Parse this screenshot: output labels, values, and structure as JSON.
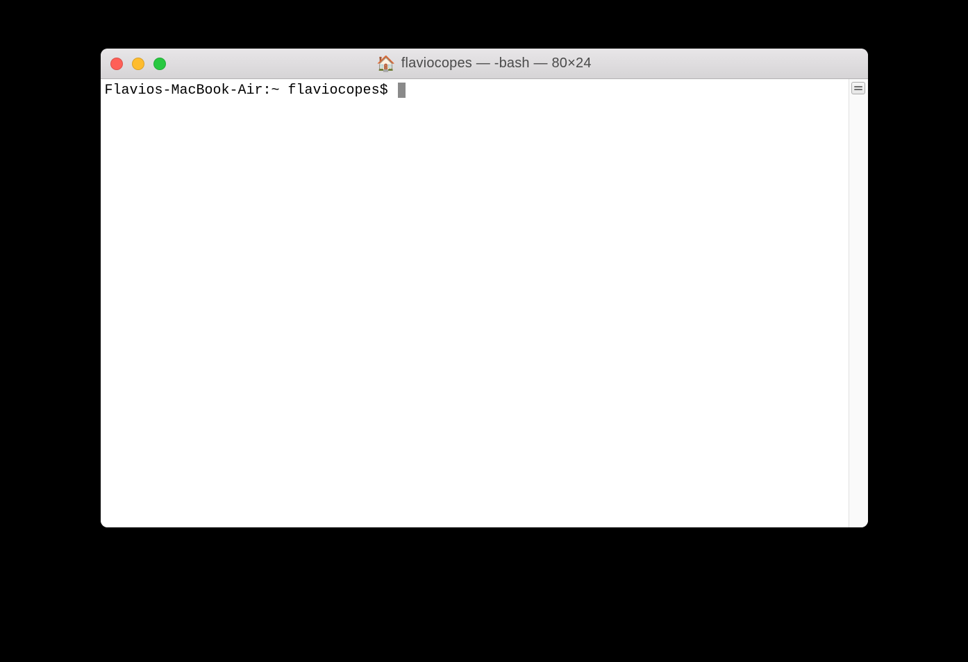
{
  "window": {
    "title": "flaviocopes — -bash — 80×24",
    "icon": "🏠"
  },
  "terminal": {
    "prompt": "Flavios-MacBook-Air:~ flaviocopes$ "
  }
}
